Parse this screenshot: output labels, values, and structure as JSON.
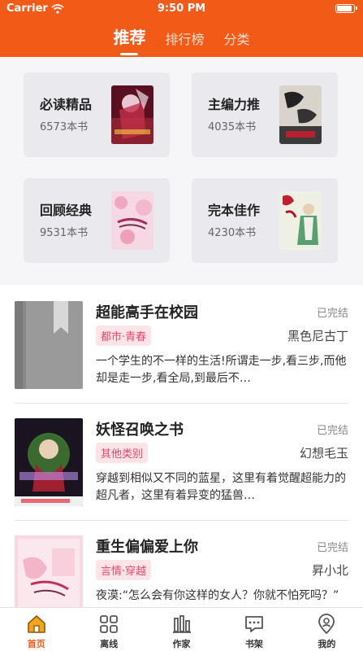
{
  "status_bar": {
    "carrier": "Carrier",
    "time": "9:50 PM"
  },
  "tabs": [
    {
      "label": "推荐",
      "active": true
    },
    {
      "label": "排行榜",
      "active": false
    },
    {
      "label": "分类",
      "active": false
    }
  ],
  "categories": [
    {
      "title": "必读精品",
      "count": "6573本书"
    },
    {
      "title": "主编力推",
      "count": "4035本书"
    },
    {
      "title": "回顾经典",
      "count": "9531本书"
    },
    {
      "title": "完本佳作",
      "count": "4230本书"
    }
  ],
  "books": [
    {
      "title": "超能高手在校园",
      "status": "已完结",
      "tag": "都市·青春",
      "author": "黑色尼古丁",
      "desc": "一个学生的不一样的生活!所谓走一步,看三步,而他却是走一步,看全局,到最后不…"
    },
    {
      "title": "妖怪召唤之书",
      "status": "已完结",
      "tag": "其他类别",
      "author": "幻想毛玉",
      "desc": "穿越到相似又不同的蓝星，这里有着觉醒超能力的超凡者，这里有着异变的猛兽…"
    },
    {
      "title": "重生偏偏爱上你",
      "status": "已完结",
      "tag": "言情·穿越",
      "author": "昇小北",
      "desc": "夜漠:“怎么会有你这样的女人？你就不怕死吗？”"
    }
  ],
  "bottom_nav": [
    {
      "label": "首页",
      "icon": "home-icon",
      "active": true
    },
    {
      "label": "离线",
      "icon": "grid-icon",
      "active": false
    },
    {
      "label": "作家",
      "icon": "writer-icon",
      "active": false
    },
    {
      "label": "书架",
      "icon": "bookshelf-icon",
      "active": false
    },
    {
      "label": "我的",
      "icon": "profile-icon",
      "active": false
    }
  ],
  "colors": {
    "accent": "#f25a17",
    "tag_bg": "#fde4e8",
    "tag_text": "#e04a6a"
  }
}
